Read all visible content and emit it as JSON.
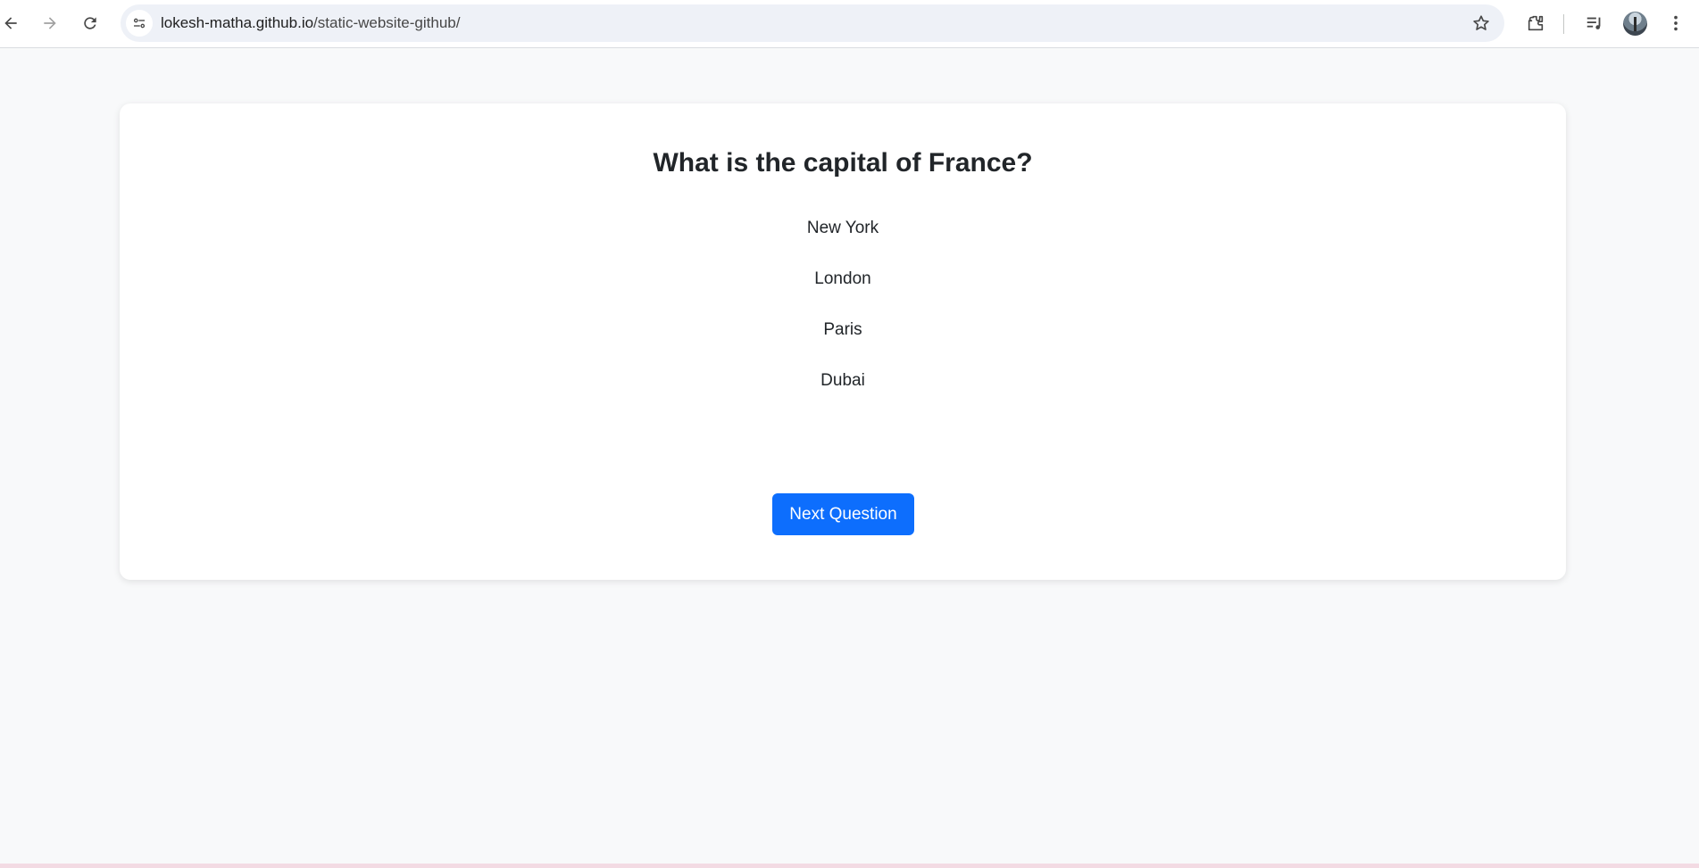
{
  "browser": {
    "url_host": "lokesh-matha.github.io",
    "url_path": "/static-website-github/",
    "icons": [
      "back-arrow-icon",
      "forward-arrow-icon",
      "reload-icon",
      "site-info-icon",
      "bookmark-star-icon",
      "extensions-icon",
      "media-controls-icon",
      "profile-avatar",
      "more-menu-icon"
    ]
  },
  "quiz": {
    "question": "What is the capital of France?",
    "options": [
      "New York",
      "London",
      "Paris",
      "Dubai"
    ],
    "next_label": "Next Question"
  },
  "colors": {
    "primary": "#0d6efd",
    "background": "#f8f9fa",
    "text": "#212529"
  }
}
